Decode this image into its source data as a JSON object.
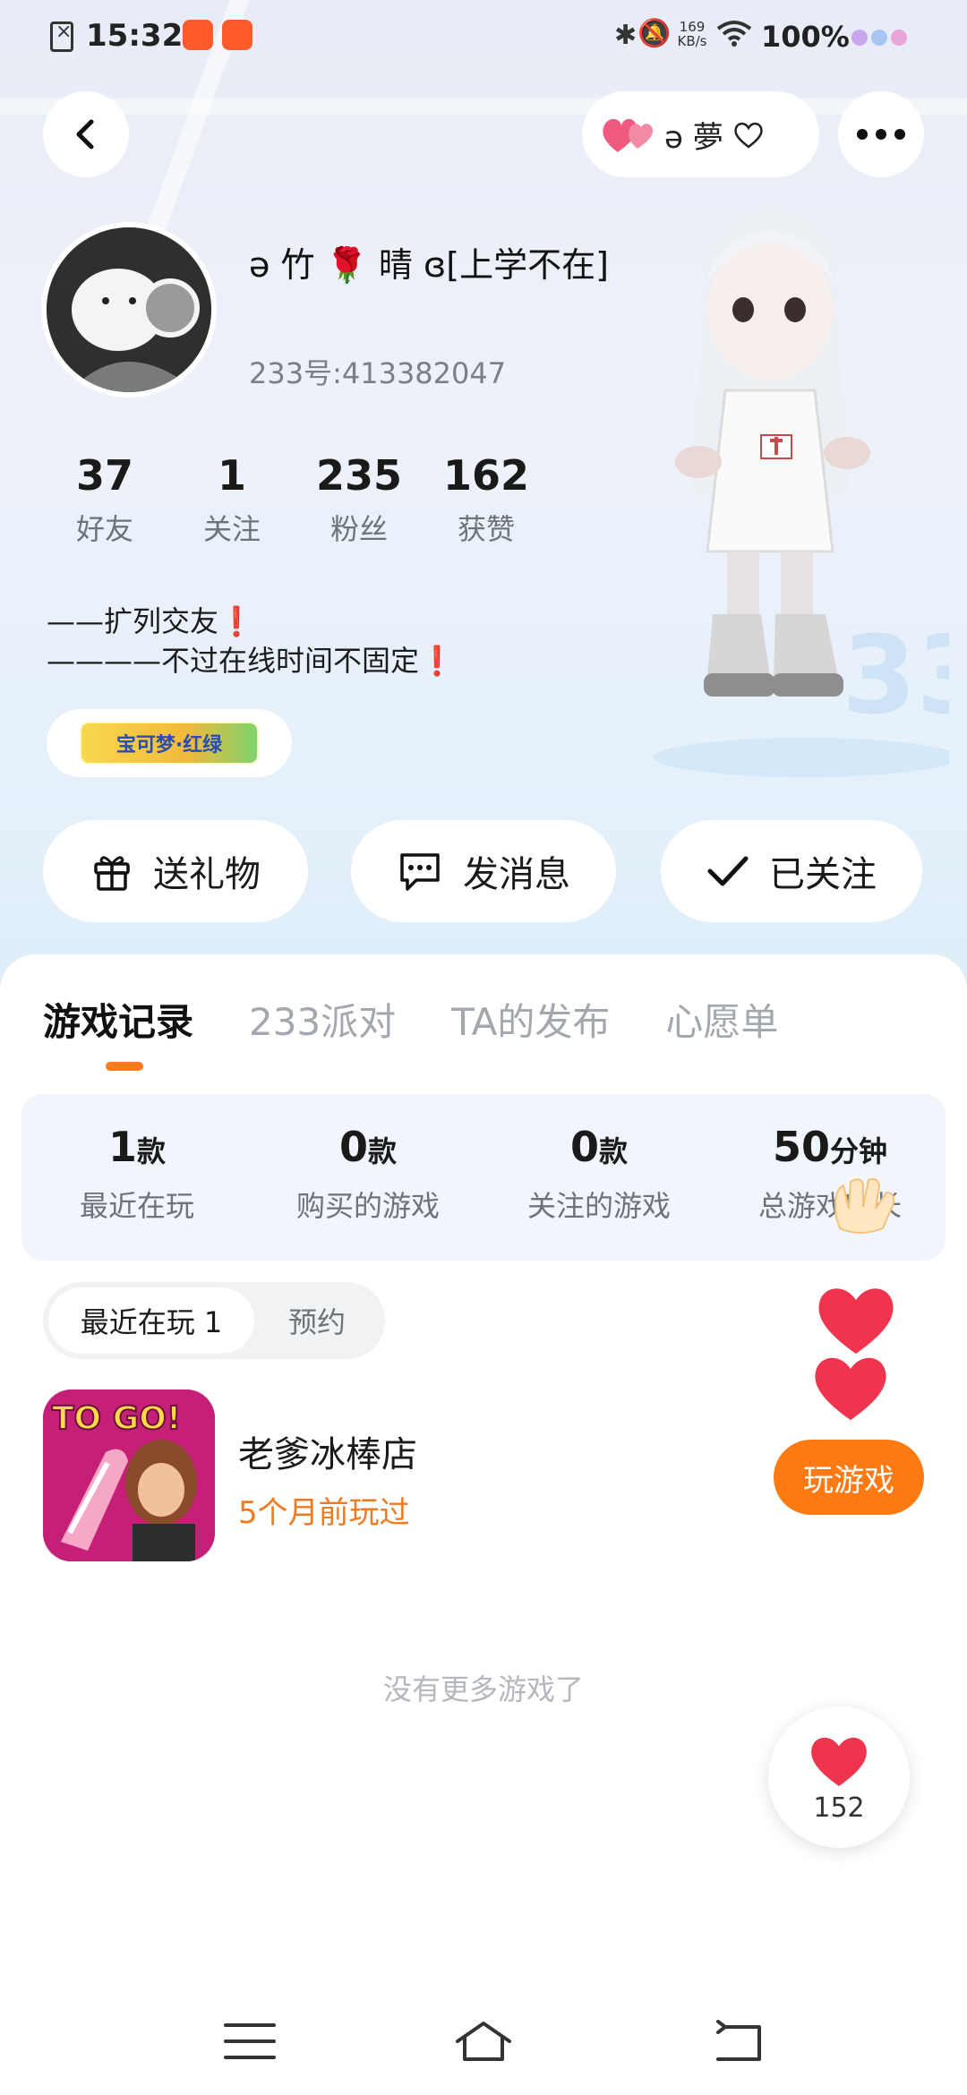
{
  "status_bar": {
    "time": "15:32",
    "network_speed_value": "169",
    "network_speed_unit": "KB/s",
    "battery": "100%"
  },
  "header": {
    "partner_name": "ə 夢",
    "back_icon": "chevron-left-icon",
    "more_icon": "more-dots-icon"
  },
  "profile": {
    "nickname": "ə 竹 🌹 晴 ɞ[上学不在]",
    "uid": "233号:413382047",
    "stats": [
      {
        "value": "37",
        "label": "好友"
      },
      {
        "value": "1",
        "label": "关注"
      },
      {
        "value": "235",
        "label": "粉丝"
      },
      {
        "value": "162",
        "label": "获赞"
      }
    ],
    "bio_line1": "——扩列交友❗",
    "bio_line2": "————不过在线时间不固定❗",
    "badge_text": "宝可梦·红绿"
  },
  "actions": {
    "gift": "送礼物",
    "message": "发消息",
    "follow": "已关注"
  },
  "tabs": [
    "游戏记录",
    "233派对",
    "TA的发布",
    "心愿单"
  ],
  "summary": [
    {
      "value": "1",
      "unit": "款",
      "label": "最近在玩"
    },
    {
      "value": "0",
      "unit": "款",
      "label": "购买的游戏"
    },
    {
      "value": "0",
      "unit": "款",
      "label": "关注的游戏"
    },
    {
      "value": "50",
      "unit": "分钟",
      "label": "总游戏时长"
    }
  ],
  "segment": {
    "recent": "最近在玩 1",
    "reserve": "预约"
  },
  "game": {
    "icon_text": "TO GO!",
    "title": "老爹冰棒店",
    "last_played": "5个月前玩过",
    "play_button": "玩游戏"
  },
  "no_more_text": "没有更多游戏了",
  "like": {
    "count": "152"
  },
  "colors": {
    "accent_orange": "#ff7a12",
    "heart_red": "#f0344e",
    "summary_bg": "#f1f6fd"
  }
}
